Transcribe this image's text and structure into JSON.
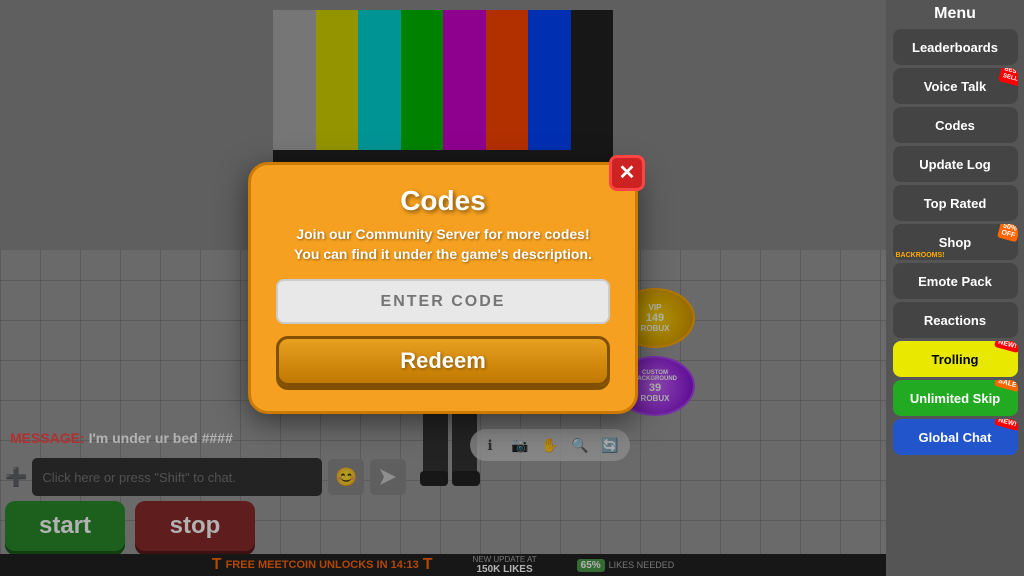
{
  "sidebar": {
    "title": "Menu",
    "buttons": [
      {
        "label": "Leaderboards",
        "id": "leaderboards",
        "type": "default",
        "badge": null
      },
      {
        "label": "Voice Talk",
        "id": "voice-talk",
        "type": "default",
        "badge": "best_seller"
      },
      {
        "label": "Codes",
        "id": "codes",
        "type": "default",
        "badge": null
      },
      {
        "label": "Update Log",
        "id": "update-log",
        "type": "default",
        "badge": null
      },
      {
        "label": "Top Rated",
        "id": "top-rated",
        "type": "default",
        "badge": null
      },
      {
        "label": "Shop",
        "id": "shop",
        "type": "default",
        "badge": "hot",
        "sublabel": "BACKROOMS!"
      },
      {
        "label": "Emote Pack",
        "id": "emote-pack",
        "type": "default",
        "badge": null
      },
      {
        "label": "Reactions",
        "id": "reactions",
        "type": "default",
        "badge": null
      },
      {
        "label": "Trolling",
        "id": "trolling",
        "type": "yellow",
        "badge": "new"
      },
      {
        "label": "Unlimited Skip",
        "id": "unlimited-skip",
        "type": "green",
        "badge": "sale"
      },
      {
        "label": "Global Chat",
        "id": "global-chat",
        "type": "blue",
        "badge": "new"
      }
    ]
  },
  "modal": {
    "title": "Codes",
    "subtitle": "Join our Community Server for more codes!\nYou can find it under the game's description.",
    "input_placeholder": "ENTER CODE",
    "redeem_label": "Redeem",
    "close_icon": "✕"
  },
  "chat": {
    "placeholder": "Click here or press \"Shift\" to chat.",
    "add_icon": "➕",
    "emoji_icon": "😊",
    "send_icon": "✈"
  },
  "action_buttons": {
    "start_label": "start",
    "stop_label": "stop"
  },
  "message": {
    "label": "MESSAGE:",
    "text": "I'm under ur bed ####"
  },
  "status_bar": {
    "free_text": "FREE MEETCOIN UNLOCKS IN 14:13",
    "t_symbol": "T",
    "new_update_label": "NEW UPDATE AT",
    "likes_label": "150K LIKES",
    "percent_label": "65%",
    "percent_sublabel": "LIKES NEEDED"
  },
  "vip": {
    "vip_label": "VIP",
    "vip_price": "149",
    "vip_currency": "ROBUX",
    "custom_label": "CUSTOM\nBACKGROUND",
    "custom_price": "39",
    "custom_currency": "ROBUX"
  },
  "colors": {
    "start_bg": "#2a8a2a",
    "stop_bg": "#8a2a2a",
    "modal_bg": "#f5a020",
    "sidebar_bg": "#555555",
    "accent_orange": "#f5a020"
  }
}
